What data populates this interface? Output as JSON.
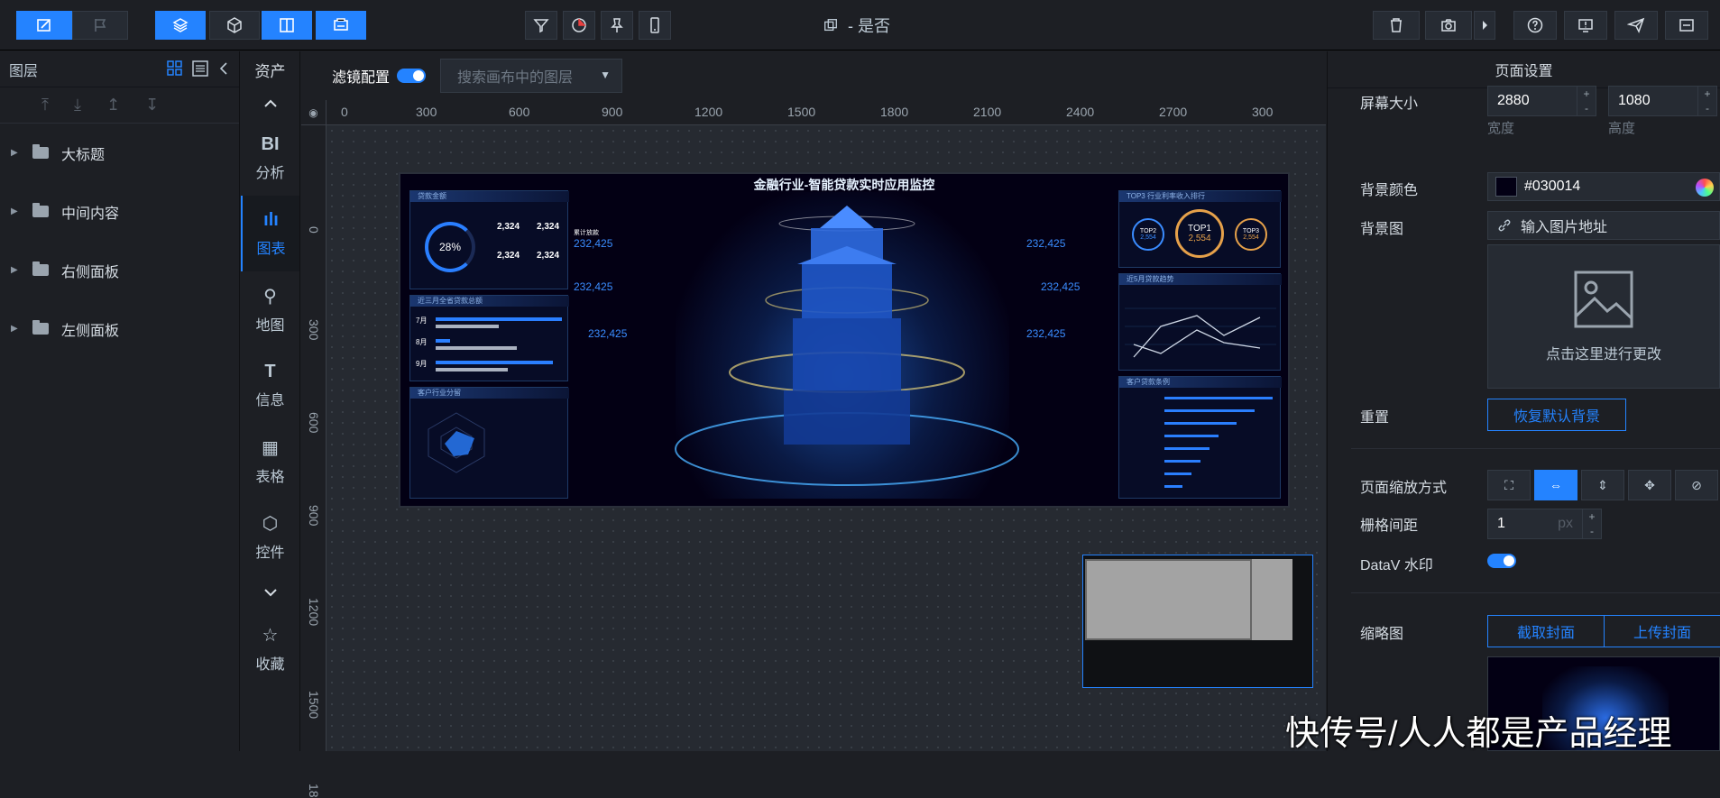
{
  "toolbar": {
    "title_suffix": "- 是否"
  },
  "layers": {
    "header": "图层",
    "items": [
      {
        "label": "大标题"
      },
      {
        "label": "中间内容"
      },
      {
        "label": "右侧面板"
      },
      {
        "label": "左侧面板"
      }
    ]
  },
  "assets": {
    "header": "资产",
    "items": [
      {
        "icon_text": "BI",
        "label": "分析"
      },
      {
        "icon_text": "ılı",
        "label": "图表"
      },
      {
        "icon_text": "⚲",
        "label": "地图"
      },
      {
        "icon_text": "T",
        "label": "信息"
      },
      {
        "icon_text": "▦",
        "label": "表格"
      },
      {
        "icon_text": "⬡",
        "label": "控件"
      },
      {
        "icon_text": "☆",
        "label": "收藏"
      }
    ]
  },
  "canvas": {
    "filter_label": "滤镜配置",
    "search_placeholder": "搜索画布中的图层",
    "ruler_h": [
      "0",
      "300",
      "600",
      "900",
      "1200",
      "1500",
      "1800",
      "2100",
      "2400",
      "2700",
      "300"
    ],
    "ruler_v": [
      "0",
      "300",
      "600",
      "900",
      "1200",
      "1500",
      "18"
    ],
    "screen": {
      "title": "金融行业-智能贷款实时应用监控",
      "panel_titles": [
        "贷款金额",
        "近三月全省贷款总额",
        "客户行业分留",
        "TOP3 行业利率收入排行",
        "近5月贷款趋势",
        "客户贷款条例"
      ],
      "gauge_value": "28%",
      "stat_value": "2,324",
      "center_value": "232,425",
      "stat_label": "累计放款",
      "top1_label": "TOP1",
      "top1_value": "2,554",
      "top2_label": "TOP2",
      "top2_value": "2,554",
      "top3_label": "TOP3",
      "top3_value": "2,554",
      "month_labels": [
        "7月",
        "8月",
        "9月"
      ]
    }
  },
  "right": {
    "header": "页面设置",
    "screen_size_label": "屏幕大小",
    "width_value": "2880",
    "height_value": "1080",
    "width_label": "宽度",
    "height_label": "高度",
    "bg_color_label": "背景颜色",
    "bg_color_value": "#030014",
    "bg_image_label": "背景图",
    "bg_image_placeholder": "输入图片地址",
    "change_text": "点击这里进行更改",
    "reset_label": "重置",
    "reset_button": "恢复默认背景",
    "zoom_label": "页面缩放方式",
    "grid_label": "栅格间距",
    "grid_value": "1",
    "grid_unit": "px",
    "watermark_label": "DataV 水印",
    "thumb_label": "缩略图",
    "capture_button": "截取封面",
    "upload_button": "上传封面"
  },
  "overlay": {
    "watermark": "快传号/人人都是产品经理"
  },
  "colors": {
    "accent": "#2483ff",
    "bg": "#1d1f24",
    "canvas_bg": "#030014"
  }
}
